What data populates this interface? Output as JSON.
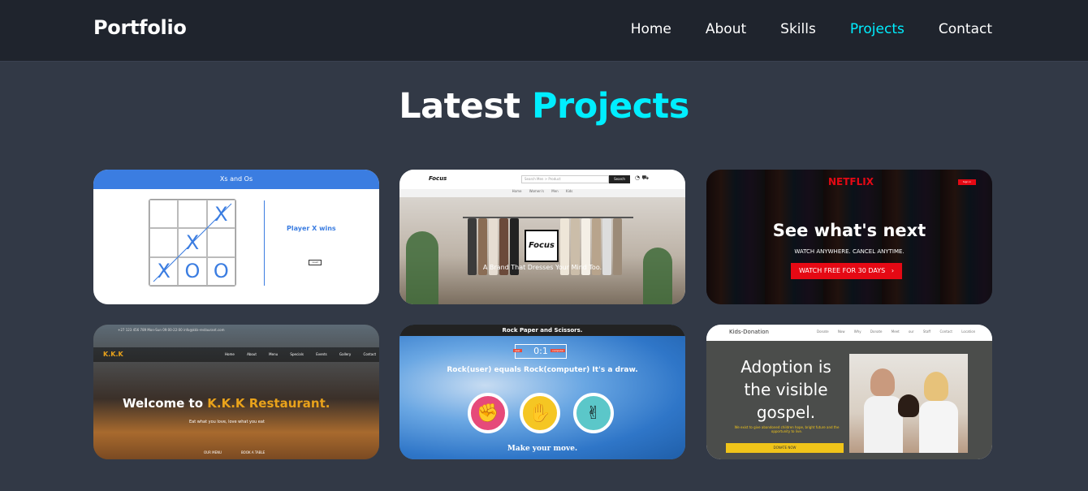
{
  "header": {
    "logo": "Portfolio",
    "nav": [
      {
        "label": "Home",
        "active": false
      },
      {
        "label": "About",
        "active": false
      },
      {
        "label": "Skills",
        "active": false
      },
      {
        "label": "Projects",
        "active": true
      },
      {
        "label": "Contact",
        "active": false
      }
    ]
  },
  "section": {
    "title_main": "Latest",
    "title_accent": "Projects"
  },
  "projects": [
    {
      "title": "Xs and Os",
      "cells": [
        "",
        "",
        "X",
        "",
        "X",
        "",
        "X",
        "O",
        "O"
      ],
      "status": "Player X wins",
      "button": "reset"
    },
    {
      "logo": "Focus",
      "search_placeholder": "Search Men > Product",
      "search_button": "Search",
      "links": "Home Women's Men Kids",
      "tagline": "A Brand That Dresses Your Mind Too."
    },
    {
      "logo": "NETFLIX",
      "sign_in": "Sign in",
      "headline": "See what's next",
      "sub": "WATCH ANYWHERE. CANCEL ANYTIME.",
      "button": "WATCH FREE FOR 30 DAYS"
    },
    {
      "topbar": "+27 123 456 789     Mon-Sun 09:00-22:00     info@kkk-restaurant.com",
      "brand": "K.K.K",
      "links": "Home About Menu Specials Events Gallery Contact",
      "welcome": "Welcome to",
      "name": "K.K.K Restaurant.",
      "tagline": "Eat what you love, love what you eat",
      "button1": "OUR MENU",
      "button2": "BOOK A TABLE"
    },
    {
      "title": "Rock Paper and Scissors.",
      "score": "0:1",
      "label_user": "user",
      "label_comp": "computer",
      "result": "Rock(user) equals Rock(computer) It's a draw.",
      "prompt": "Make your move."
    },
    {
      "brand": "Kids-Donation",
      "links": "Donate Now Why Donate Meet our Staff Contact Location",
      "headline": "Adoption is the visible gospel.",
      "sub": "We exist to give abandoned children hope, bright future and the opportunity to live.",
      "button": "DONATE NOW"
    }
  ],
  "colors": {
    "background": "#323946",
    "header": "#1f242d",
    "accent": "#00eeff"
  }
}
